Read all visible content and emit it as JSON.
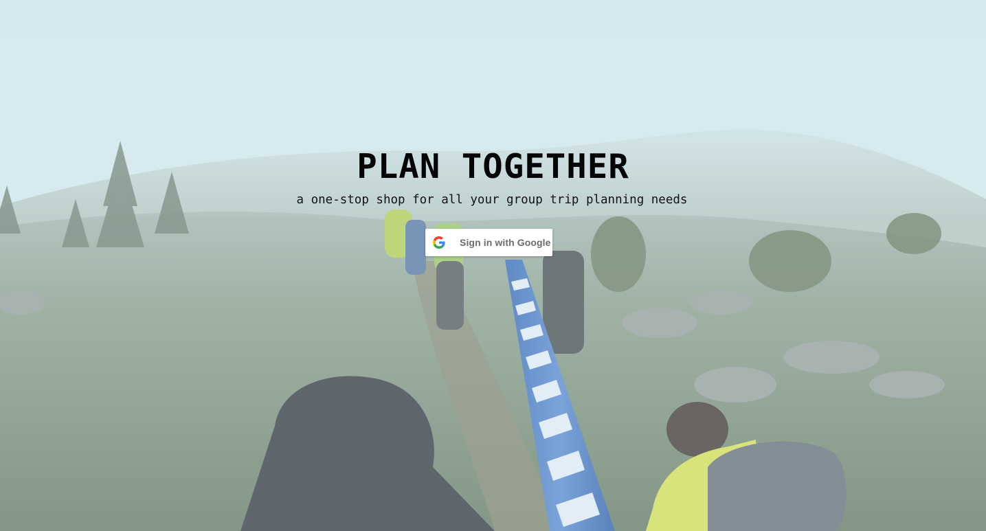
{
  "hero": {
    "title": "PLAN TOGETHER",
    "subtitle": "a one-stop shop for all your group trip planning needs"
  },
  "signin": {
    "label": "Sign in with Google",
    "icon": "google-g-icon"
  },
  "colors": {
    "sky": "#d6e9ef",
    "title_text": "#050505",
    "button_bg": "#ffffff",
    "button_text": "#6b6b6b",
    "google_blue": "#4285F4",
    "google_red": "#EA4335",
    "google_yellow": "#FBBC05",
    "google_green": "#34A853"
  }
}
